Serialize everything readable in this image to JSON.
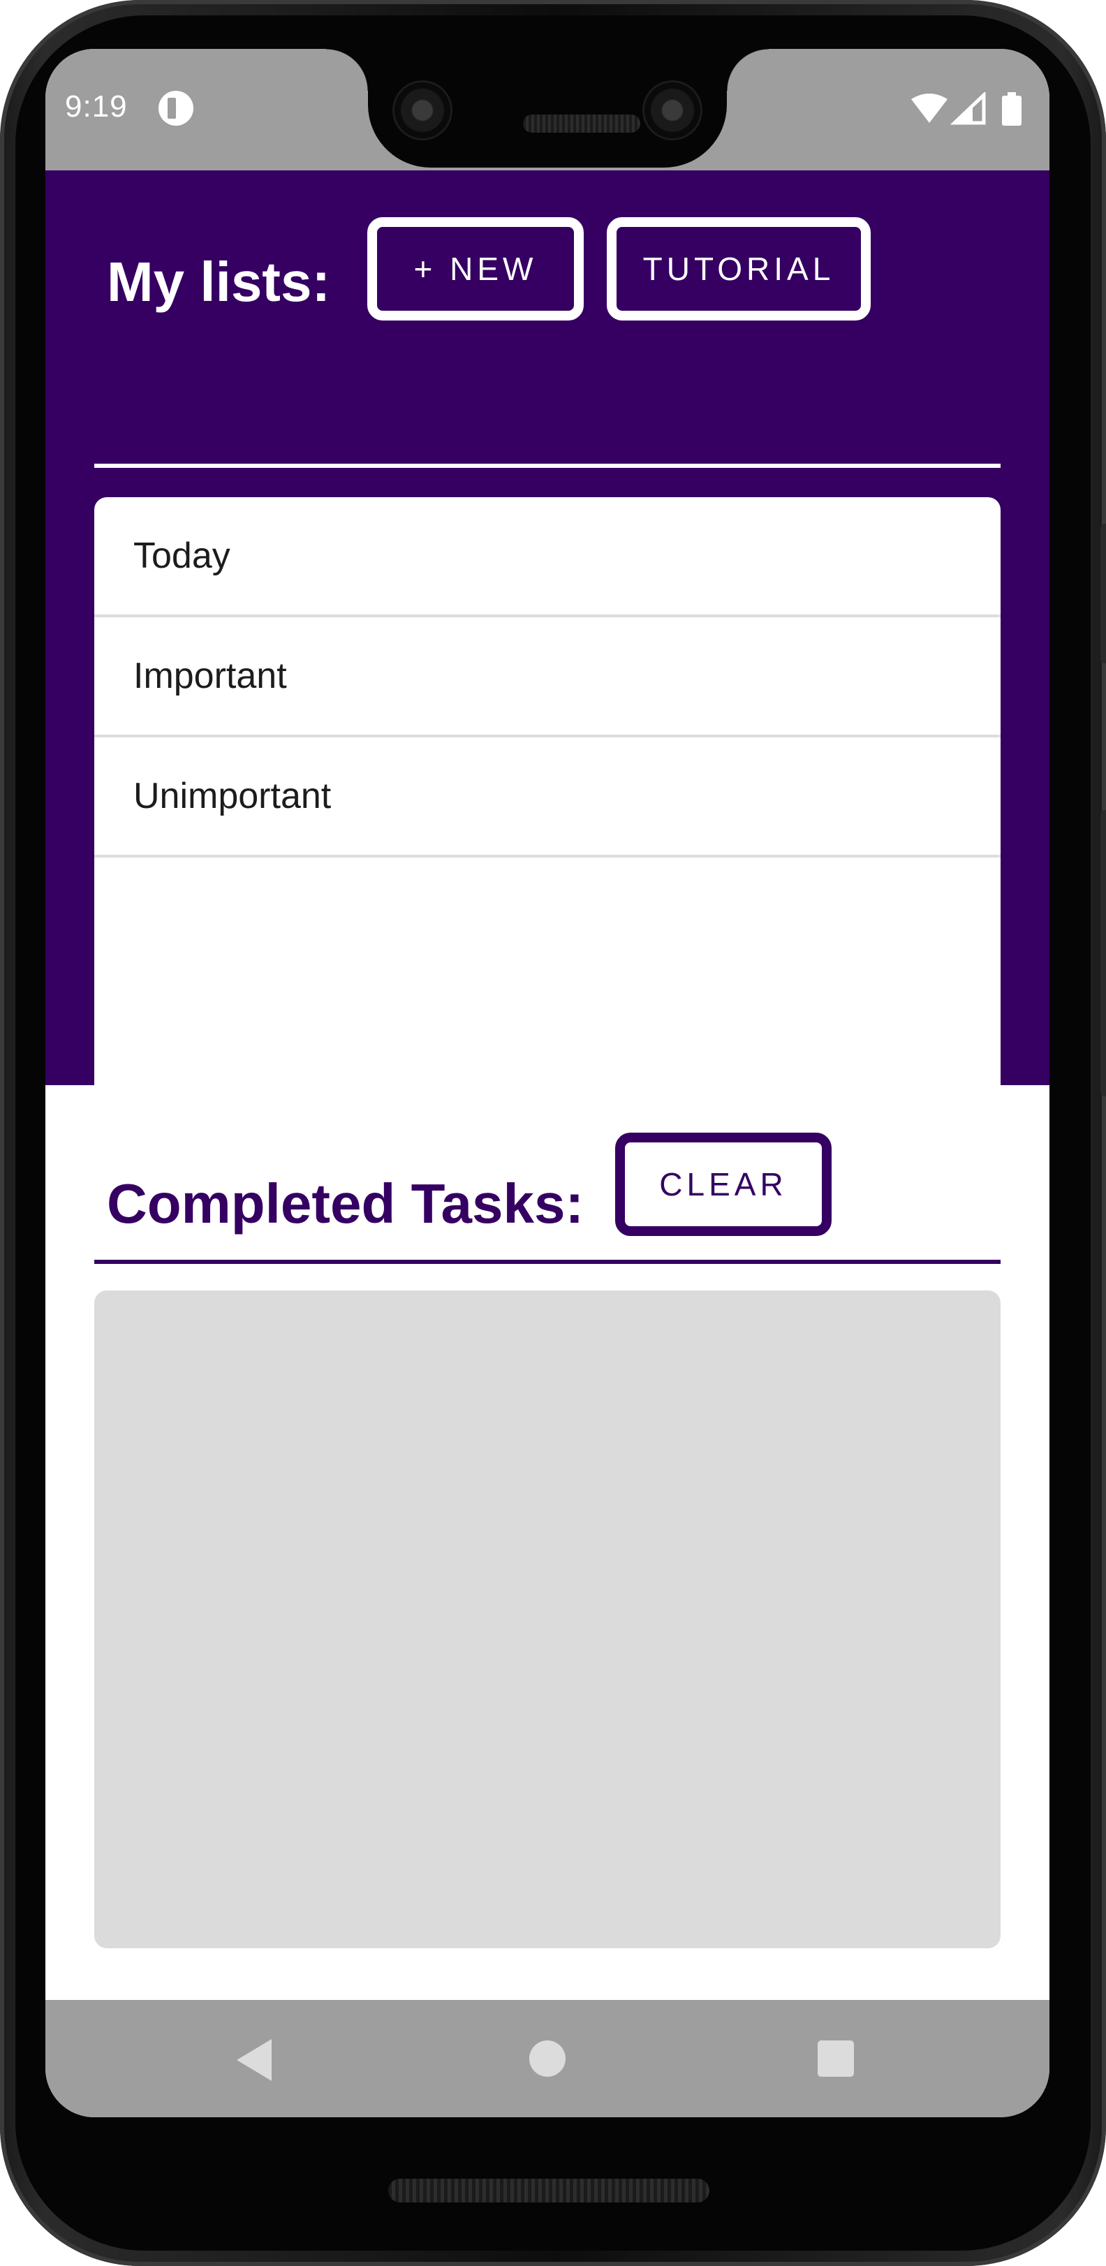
{
  "status_bar": {
    "time": "9:19",
    "icons": [
      "app-notification-icon",
      "wifi-icon",
      "cellular-signal-icon",
      "battery-icon"
    ]
  },
  "my_lists": {
    "title": "My lists:",
    "new_button": "+ NEW",
    "tutorial_button": "TUTORIAL",
    "items": [
      {
        "label": "Today"
      },
      {
        "label": "Important"
      },
      {
        "label": "Unimportant"
      }
    ]
  },
  "completed": {
    "title": "Completed Tasks:",
    "clear_button": "CLEAR",
    "tasks": []
  },
  "nav_bar": {
    "icons": [
      "back-icon",
      "home-icon",
      "recent-apps-icon"
    ]
  },
  "colors": {
    "primary": "#350062",
    "status_bar": "#9e9e9e",
    "completed_background": "#dbdbdb",
    "white": "#ffffff"
  }
}
